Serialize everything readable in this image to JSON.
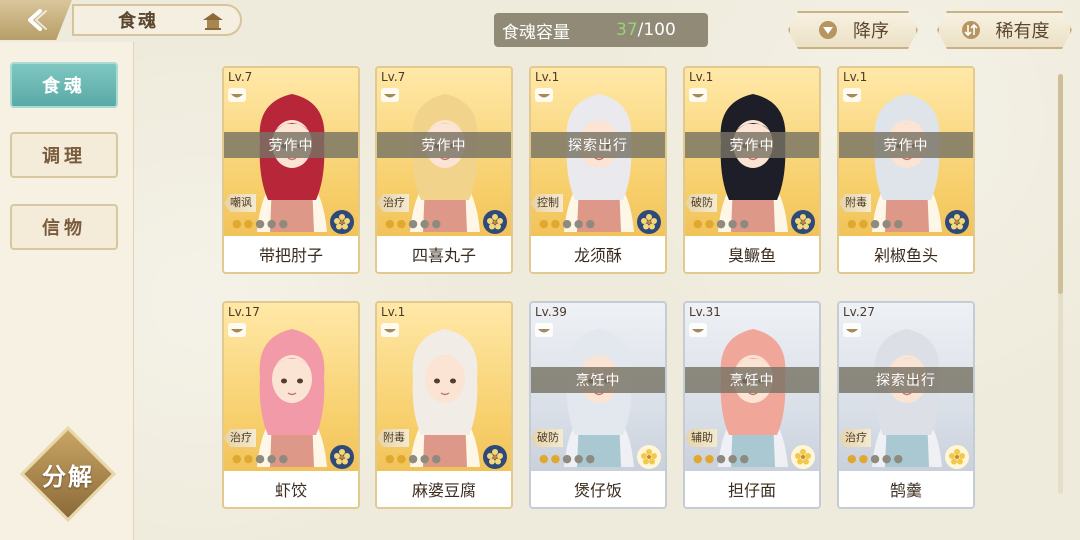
{
  "header": {
    "title": "食魂",
    "capacity_label": "食魂容量",
    "capacity_current": "37",
    "capacity_max": "/100",
    "sort_desc_label": "降序",
    "sort_rarity_label": "稀有度"
  },
  "sidebar": {
    "tabs": [
      {
        "label": "食魂"
      },
      {
        "label": "调理"
      },
      {
        "label": "信物"
      }
    ],
    "decompose_label": "分解"
  },
  "cards": [
    {
      "level": "Lv.7",
      "status": "劳作中",
      "role": "嘲讽",
      "name": "带把肘子",
      "hair": "#b8263a",
      "rarity": "gold",
      "flower": "#2d4a7a"
    },
    {
      "level": "Lv.7",
      "status": "劳作中",
      "role": "治疗",
      "name": "四喜丸子",
      "hair": "#f2d38c",
      "rarity": "gold",
      "flower": "#2d4a7a"
    },
    {
      "level": "Lv.1",
      "status": "探索出行",
      "role": "控制",
      "name": "龙须酥",
      "hair": "#e9e9ee",
      "rarity": "gold",
      "flower": "#2d4a7a"
    },
    {
      "level": "Lv.1",
      "status": "劳作中",
      "role": "破防",
      "name": "臭鳜鱼",
      "hair": "#1e1e28",
      "rarity": "gold",
      "flower": "#2d4a7a"
    },
    {
      "level": "Lv.1",
      "status": "劳作中",
      "role": "附毒",
      "name": "剁椒鱼头",
      "hair": "#dfe3ea",
      "rarity": "gold",
      "flower": "#2d4a7a"
    },
    {
      "level": "Lv.17",
      "status": "",
      "role": "治疗",
      "name": "虾饺",
      "hair": "#f29aa8",
      "rarity": "gold",
      "flower": "#2d4a7a"
    },
    {
      "level": "Lv.1",
      "status": "",
      "role": "附毒",
      "name": "麻婆豆腐",
      "hair": "#f1ece6",
      "rarity": "gold",
      "flower": "#2d4a7a"
    },
    {
      "level": "Lv.39",
      "status": "烹饪中",
      "role": "破防",
      "name": "煲仔饭",
      "hair": "#e3e7ee",
      "rarity": "silver",
      "flower": "#f2c94c"
    },
    {
      "level": "Lv.31",
      "status": "烹饪中",
      "role": "辅助",
      "name": "担仔面",
      "hair": "#f0a79a",
      "rarity": "silver",
      "flower": "#f2c94c"
    },
    {
      "level": "Lv.27",
      "status": "探索出行",
      "role": "治疗",
      "name": "鹄羹",
      "hair": "#dcdfe6",
      "rarity": "silver",
      "flower": "#f2c94c"
    }
  ],
  "colors": {
    "accent_teal": "#6bb8b4",
    "gold_frame": "#e2c98e",
    "capacity_current": "#8fd26b"
  },
  "icons": {
    "back": "back-arrow-icon",
    "sort_desc": "triangle-down-icon",
    "sort_rarity": "sort-arrows-icon"
  }
}
